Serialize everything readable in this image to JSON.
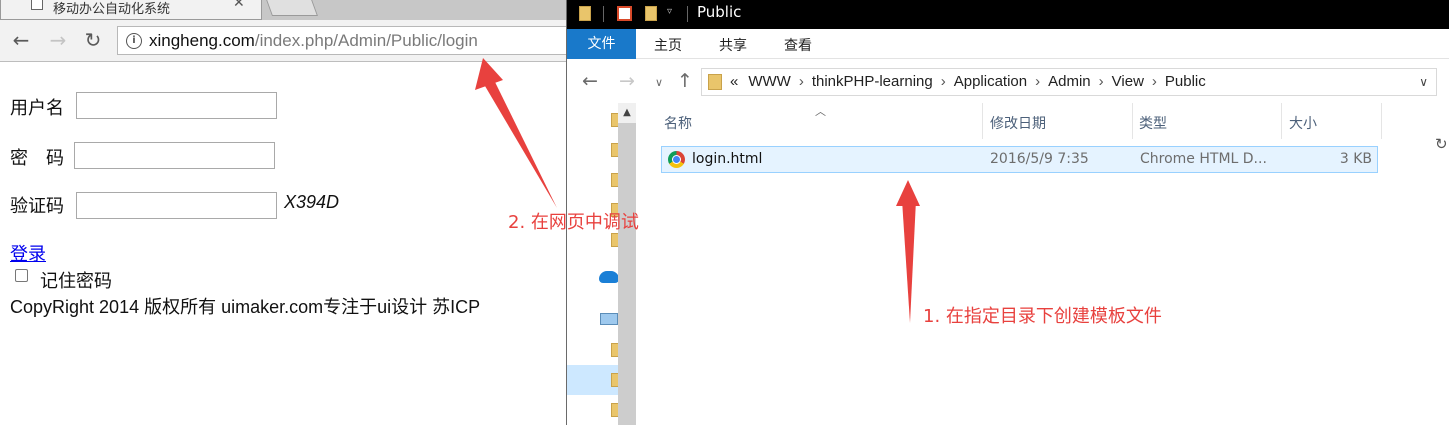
{
  "browser": {
    "tab_title": "移动办公自动化系统",
    "url_host": "xingheng.com",
    "url_path": "/index.php/Admin/Public/login",
    "form": {
      "username_label": "用户名",
      "password_label": "密　码",
      "captcha_label": "验证码",
      "captcha_text": "X394D",
      "login_link": "登录",
      "remember_label": "记住密码",
      "copyright": "CopyRight 2014  版权所有  uimaker.com专注于ui设计  苏ICP"
    }
  },
  "explorer": {
    "title": "Public",
    "ribbon_tabs": [
      "文件",
      "主页",
      "共享",
      "查看"
    ],
    "breadcrumb": [
      "«",
      "WWW",
      "thinkPHP-learning",
      "Application",
      "Admin",
      "View",
      "Public"
    ],
    "columns": [
      "名称",
      "修改日期",
      "类型",
      "大小"
    ],
    "files": [
      {
        "name": "login.html",
        "modified": "2016/5/9 7:35",
        "type": "Chrome HTML D...",
        "size": "3 KB"
      }
    ]
  },
  "annotations": {
    "step1": "1. 在指定目录下创建模板文件",
    "step2": "2. 在网页中调试",
    "color": "#e8413e"
  }
}
